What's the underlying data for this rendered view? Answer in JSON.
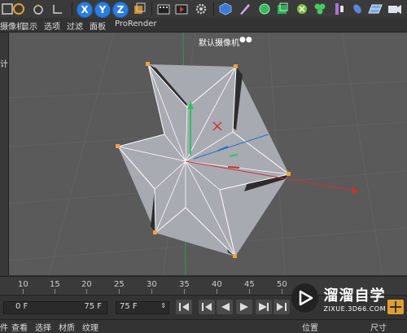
{
  "toolbar": {
    "axis_x": "X",
    "axis_y": "Y",
    "axis_z": "Z"
  },
  "menubar": {
    "items": [
      "摄像机",
      "显示",
      "选项",
      "过滤",
      "面板",
      "ProRender"
    ]
  },
  "left_panel": {
    "label": "计"
  },
  "viewport": {
    "camera_label": "默认摄像机",
    "camera_icon": "camera-dots-icon"
  },
  "timeline": {
    "ticks": [
      "10",
      "15",
      "20",
      "25",
      "30",
      "35",
      "40",
      "45",
      "50"
    ]
  },
  "controls": {
    "start_frame": "0 F",
    "end_frame": "75 F",
    "current_frame": "75 F"
  },
  "bottom_menu": {
    "items": [
      "件",
      "查看",
      "选择",
      "材质",
      "纹理"
    ],
    "right_items": [
      "位置",
      "尺寸"
    ]
  },
  "watermark": {
    "title": "溜溜自学",
    "subtitle": "ZIXUE.3D66.COM"
  },
  "colors": {
    "accent_blue": "#2b7de0",
    "viewport_bg": "#5a5a5a",
    "point_orange": "#f0a040",
    "axis_red": "#d03030",
    "axis_green": "#30c060",
    "axis_blue": "#2070d0"
  }
}
